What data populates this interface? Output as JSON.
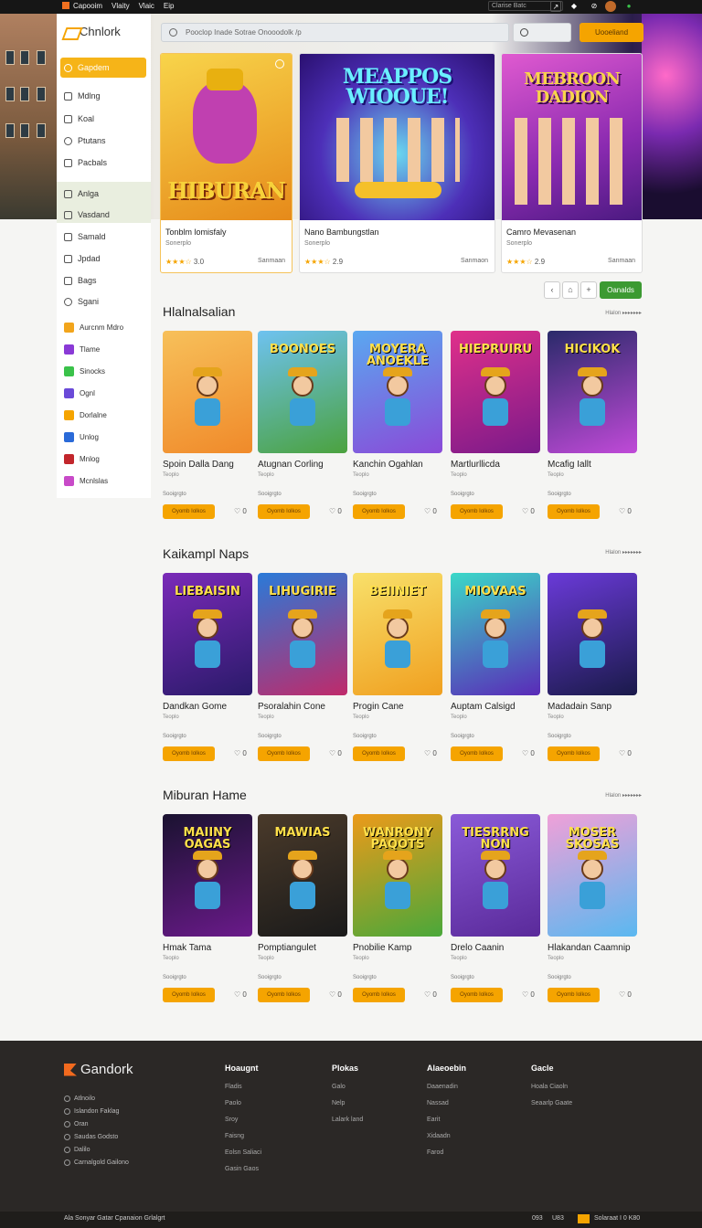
{
  "topbar": {
    "menu": [
      "Capooim",
      "Vlaity",
      "Vlaic",
      "Eip"
    ],
    "search_placeholder": "Clarise Batc",
    "icons": [
      "settings-icon",
      "shield-icon",
      "fire-icon",
      "avatar",
      "status-icon"
    ]
  },
  "sidebar": {
    "logo": "Chnlork",
    "items": [
      {
        "label": "Gapdem",
        "icon": "home-icon",
        "active": true
      },
      {
        "label": "Mdlng",
        "icon": "grid-icon"
      },
      {
        "label": "Koal",
        "icon": "image-icon"
      },
      {
        "label": "Ptutans",
        "icon": "chat-icon"
      },
      {
        "label": "Pacbals",
        "icon": "folder-icon"
      },
      {
        "label": "Anlga",
        "icon": "edit-icon"
      },
      {
        "label": "Vasdand",
        "icon": "check-icon"
      },
      {
        "label": "Samald",
        "icon": "mail-icon"
      },
      {
        "label": "Jpdad",
        "icon": "upload-icon"
      },
      {
        "label": "Bags",
        "icon": "edit-icon"
      },
      {
        "label": "Sgani",
        "icon": "settings-icon"
      }
    ],
    "apps": [
      {
        "label": "Aurcnm Mdro",
        "color": "#f2a51c"
      },
      {
        "label": "Tlame",
        "color": "#8a3ad6"
      },
      {
        "label": "Sinocks",
        "color": "#3ac24a"
      },
      {
        "label": "Ognl",
        "color": "#6a4ad8"
      },
      {
        "label": "Dorlalne",
        "color": "#f5a400"
      },
      {
        "label": "Unlog",
        "color": "#2a6ad8"
      },
      {
        "label": "Mnlog",
        "color": "#c2262c"
      },
      {
        "label": "Mcnlslas",
        "color": "#c84ac8"
      }
    ]
  },
  "search": {
    "placeholder": "Pooclop Inade Sotrae Onooodolk /p",
    "cta": "Uooeliand"
  },
  "featured": [
    {
      "art_text": "HIBURAN",
      "title": "Tonblm lomisfaly",
      "sub": "Sonerplo",
      "rating": "3.0",
      "stars": "★★★☆",
      "price": "Sanmaan",
      "bg": "#f6c42a"
    },
    {
      "art_text": "MEAPPOS WIOOUE!",
      "title": "Nano Bambungstlan",
      "sub": "Sonerplo",
      "rating": "2.9",
      "stars": "★★★☆",
      "price": "Sanmaon",
      "bg": "#4d2fb8"
    },
    {
      "art_text": "MEBROON DADION",
      "title": "Camro Mevasenan",
      "sub": "Sonerplo",
      "rating": "2.9",
      "stars": "★★★☆",
      "price": "Sanmaan",
      "bg": "#c13bb4"
    }
  ],
  "pager": {
    "go": "Oanalds"
  },
  "sections": [
    {
      "title": "Hlalnalsalian",
      "more": "Hlalon ▸▸▸▸▸▸▸",
      "games": [
        {
          "art_text": "",
          "title": "Spoin Dalla Dang",
          "sub": "Teoplo",
          "meta": "Sooigrgto",
          "btn": "Oyomb Iolkos",
          "count": "0",
          "bg1": "#f7c05a",
          "bg2": "#f08a2a"
        },
        {
          "art_text": "BOONOES",
          "title": "Atugnan Corling",
          "sub": "Teoplo",
          "meta": "Sooigrgto",
          "btn": "Oyomb Iolkos",
          "count": "0",
          "bg1": "#6ec2f0",
          "bg2": "#4ba23e"
        },
        {
          "art_text": "MOYERA ANOEKLE",
          "title": "Kanchin Ogahlan",
          "sub": "Teoplo",
          "meta": "Sooigrgto",
          "btn": "Oyomb Iolkos",
          "count": "0",
          "bg1": "#5aa8f0",
          "bg2": "#8a4ad8"
        },
        {
          "art_text": "HIEPRUIRU",
          "title": "Martlurllicda",
          "sub": "Teoplo",
          "meta": "Sooigrgto",
          "btn": "Oyomb Iolkos",
          "count": "0",
          "bg1": "#e0308a",
          "bg2": "#7a1a8a"
        },
        {
          "art_text": "HICIKOK",
          "title": "Mcafig Iallt",
          "sub": "Teoplo",
          "meta": "Sooigrgto",
          "btn": "Oyomb Iolkos",
          "count": "0",
          "bg1": "#2a2a6a",
          "bg2": "#c04ad8"
        }
      ]
    },
    {
      "title": "Kaikampl Naps",
      "more": "Hlalon ▸▸▸▸▸▸▸",
      "games": [
        {
          "art_text": "LIEBAISIN",
          "title": "Dandkan Gome",
          "sub": "Teoplo",
          "meta": "Sooigrgto",
          "btn": "Oyomb Iolkos",
          "count": "0",
          "bg1": "#7a2ab8",
          "bg2": "#2a1a6a"
        },
        {
          "art_text": "LIHUGIRIE",
          "title": "Psoralahin Cone",
          "sub": "Teoplo",
          "meta": "Sooigrgto",
          "btn": "Oyomb Iolkos",
          "count": "0",
          "bg1": "#2a7ad8",
          "bg2": "#c02a6a"
        },
        {
          "art_text": "BEIINIET",
          "title": "Progin Cane",
          "sub": "Teoplo",
          "meta": "Sooigrgto",
          "btn": "Oyomb Iolkos",
          "count": "0",
          "bg1": "#f8e06a",
          "bg2": "#f0a020"
        },
        {
          "art_text": "MIOVAAS",
          "title": "Auptam Calsigd",
          "sub": "Teoplo",
          "meta": "Sooigrgto",
          "btn": "Oyomb Iolkos",
          "count": "0",
          "bg1": "#3ad8c8",
          "bg2": "#5a2ab8"
        },
        {
          "art_text": "",
          "title": "Madadain Sanp",
          "sub": "Teoplo",
          "meta": "Sooigrgto",
          "btn": "Oyomb Iolkos",
          "count": "0",
          "bg1": "#6a3ad8",
          "bg2": "#1a1a4a"
        }
      ]
    },
    {
      "title": "Miburan Hame",
      "more": "Hlalon ▸▸▸▸▸▸▸",
      "games": [
        {
          "art_text": "MAIINY OAGAS",
          "title": "Hmak Tama",
          "sub": "Teoplo",
          "meta": "Sooigrgto",
          "btn": "Oyomb Iolkos",
          "count": "0",
          "bg1": "#1a1230",
          "bg2": "#6a1a8a"
        },
        {
          "art_text": "MAWIAS",
          "title": "Pomptiangulet",
          "sub": "Teoplo",
          "meta": "Sooigrgto",
          "btn": "Oyomb Iolkos",
          "count": "0",
          "bg1": "#4a3a2a",
          "bg2": "#1a1a1a"
        },
        {
          "art_text": "WANRONY PAQOTS",
          "title": "Pnobilie Kamp",
          "sub": "Teoplo",
          "meta": "Sooigrgto",
          "btn": "Oyomb Iolkos",
          "count": "0",
          "bg1": "#ec9a1a",
          "bg2": "#4aa83a"
        },
        {
          "art_text": "TIESRRNG NON",
          "title": "Drelo Caanin",
          "sub": "Teoplo",
          "meta": "Sooigrgto",
          "btn": "Oyomb Iolkos",
          "count": "0",
          "bg1": "#8a5ad8",
          "bg2": "#5a2a9a"
        },
        {
          "art_text": "MOSER SKOSAS",
          "title": "Hlakandan Caamnip",
          "sub": "Teoplo",
          "meta": "Sooigrgto",
          "btn": "Oyomb Iolkos",
          "count": "0",
          "bg1": "#f0a0d8",
          "bg2": "#5ab8f0"
        }
      ]
    }
  ],
  "footer": {
    "logo": "Gandork",
    "contacts": [
      "Atlnoilo",
      "Islandon Faklag",
      "Oran",
      "Saudas Godsto",
      "Dalilo",
      "Carnalgold Gailono"
    ],
    "columns": [
      {
        "heading": "Hoaugnt",
        "items": [
          "Fladis",
          "Paolo",
          "Sroy",
          "Faisng",
          "Eolsn Saliaci",
          "Gasin Gaos"
        ]
      },
      {
        "heading": "Plokas",
        "items": [
          "Galo",
          "Nelp",
          "Lalark land"
        ]
      },
      {
        "heading": "Alaeoebin",
        "items": [
          "Daaenadin",
          "Nassad",
          "Earit",
          "Xidaadn",
          "Farod"
        ]
      },
      {
        "heading": "Gacle",
        "items": [
          "Hoala Ciaoln",
          "Seaarlp Gaate"
        ]
      }
    ],
    "bottom_left": "Ala  Sonyar  Gatar  Cpanaion Grlalgrt",
    "bottom_right": [
      "093",
      "U83",
      "Solaraat I 0 K80"
    ]
  }
}
